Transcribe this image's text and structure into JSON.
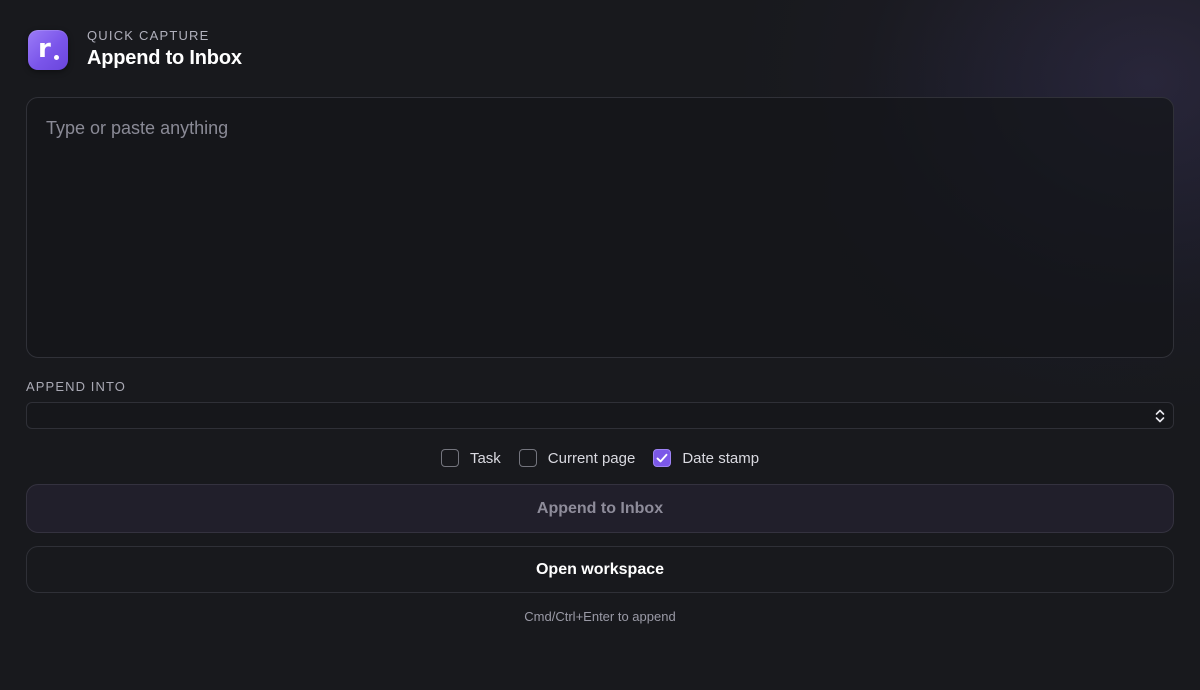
{
  "header": {
    "logo_letter": "r",
    "eyebrow": "QUICK CAPTURE",
    "title": "Append to Inbox",
    "accent_color": "#7b58e8"
  },
  "capture": {
    "value": "",
    "placeholder": "Type or paste anything"
  },
  "append_into": {
    "label": "APPEND INTO",
    "selected_value": ""
  },
  "options": [
    {
      "label": "Task",
      "checked": false
    },
    {
      "label": "Current page",
      "checked": false
    },
    {
      "label": "Date stamp",
      "checked": true
    }
  ],
  "actions": {
    "primary_label": "Append to Inbox",
    "secondary_label": "Open workspace"
  },
  "hint": "Cmd/Ctrl+Enter to append"
}
